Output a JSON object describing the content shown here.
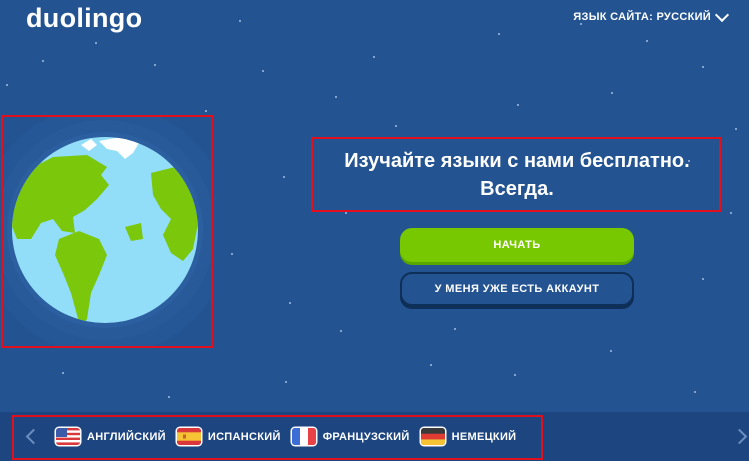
{
  "header": {
    "logo": "duolingo",
    "site_language_label": "ЯЗЫК САЙТА: РУССКИЙ"
  },
  "hero": {
    "title_line1": "Изучайте языки с нами бесплатно.",
    "title_line2": "Всегда.",
    "start_button": "НАЧАТЬ",
    "login_button": "У МЕНЯ УЖЕ ЕСТЬ АККАУНТ"
  },
  "language_bar": {
    "items": [
      {
        "label": "АНГЛИЙСКИЙ",
        "flag": "us-flag-icon"
      },
      {
        "label": "ИСПАНСКИЙ",
        "flag": "spain-flag-icon"
      },
      {
        "label": "ФРАНЦУЗСКИЙ",
        "flag": "france-flag-icon"
      },
      {
        "label": "НЕМЕЦКИЙ",
        "flag": "germany-flag-icon"
      }
    ]
  },
  "colors": {
    "background": "#235390",
    "accent_green": "#78c800",
    "highlight_red": "#e0101f"
  }
}
